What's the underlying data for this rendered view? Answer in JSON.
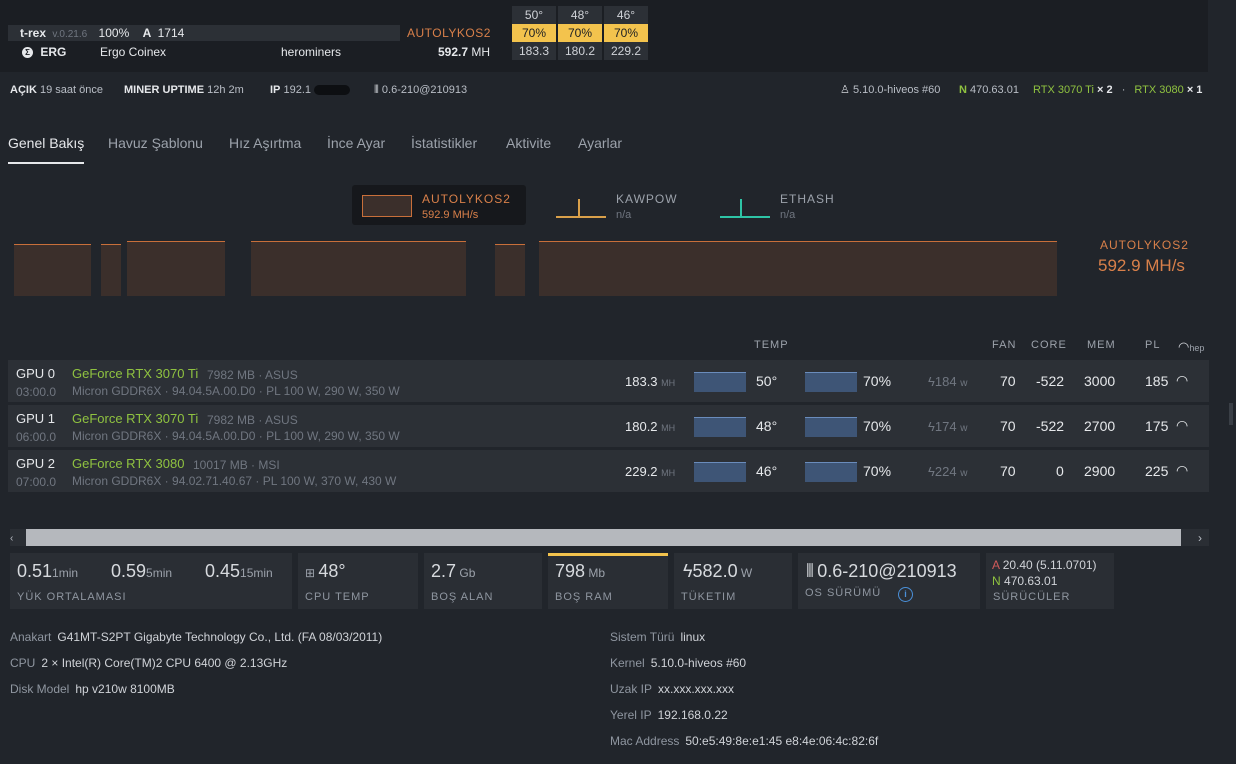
{
  "miner": {
    "name": "t-rex",
    "version": "v.0.21.6",
    "percent": "100%",
    "a_label": "A",
    "a_value": "1714",
    "algo": "AUTOLYKOS2",
    "coin": "ERG",
    "coin_name": "Ergo Coinex",
    "pool": "herominers",
    "hashrate": "592.7",
    "hash_unit": "MH"
  },
  "top_gpus": [
    {
      "temp": "50°",
      "fan": "70%",
      "hash": "183.3"
    },
    {
      "temp": "48°",
      "fan": "70%",
      "hash": "180.2"
    },
    {
      "temp": "46°",
      "fan": "70%",
      "hash": "229.2"
    }
  ],
  "status": {
    "on_label": "AÇIK",
    "on_value": "19 saat önce",
    "uptime_label": "MINER UPTIME",
    "uptime_value": "12h 2m",
    "ip_label": "IP",
    "ip_value": "192.1",
    "version": "0.6-210@210913",
    "kernel": "5.10.0-hiveos #60",
    "nvidia_driver": "470.63.01",
    "gpu_model_1": "RTX 3070 Ti",
    "gpu_count_1": "× 2",
    "gpu_model_2": "RTX 3080",
    "gpu_count_2": "× 1"
  },
  "tabs": [
    "Genel Bakış",
    "Havuz Şablonu",
    "Hız Aşırtma",
    "İnce Ayar",
    "İstatistikler",
    "Aktivite",
    "Ayarlar"
  ],
  "algos": [
    {
      "name": "AUTOLYKOS2",
      "value": "592.9 MH/s",
      "color": "#d9804a"
    },
    {
      "name": "KAWPOW",
      "value": "n/a",
      "color": "#d9a04a"
    },
    {
      "name": "ETHASH",
      "value": "n/a",
      "color": "#2ec4a6"
    }
  ],
  "chart_summary": {
    "name": "AUTOLYKOS2",
    "value": "592.9 MH/s"
  },
  "table_headers": {
    "temp": "TEMP",
    "fan": "FAN",
    "core": "CORE",
    "mem": "MEM",
    "pl": "PL",
    "hep": "hep"
  },
  "gpus": [
    {
      "id": "GPU 0",
      "bus": "03:00.0",
      "model": "GeForce RTX 3070 Ti",
      "vram": "7982 MB · ASUS",
      "details": "Micron GDDR6X · 94.04.5A.00.D0 · PL 100 W, 290 W, 350 W",
      "hash": "183.3",
      "hash_unit": "MH",
      "temp": "50°",
      "fan_pct": "70%",
      "power": "184",
      "power_unit": "w",
      "fan": "70",
      "core": "-522",
      "mem": "3000",
      "pl": "185"
    },
    {
      "id": "GPU 1",
      "bus": "06:00.0",
      "model": "GeForce RTX 3070 Ti",
      "vram": "7982 MB · ASUS",
      "details": "Micron GDDR6X · 94.04.5A.00.D0 · PL 100 W, 290 W, 350 W",
      "hash": "180.2",
      "hash_unit": "MH",
      "temp": "48°",
      "fan_pct": "70%",
      "power": "174",
      "power_unit": "w",
      "fan": "70",
      "core": "-522",
      "mem": "2700",
      "pl": "175"
    },
    {
      "id": "GPU 2",
      "bus": "07:00.0",
      "model": "GeForce RTX 3080",
      "vram": "10017 MB · MSI",
      "details": "Micron GDDR6X · 94.02.71.40.67 · PL 100 W, 370 W, 430 W",
      "hash": "229.2",
      "hash_unit": "MH",
      "temp": "46°",
      "fan_pct": "70%",
      "power": "224",
      "power_unit": "w",
      "fan": "70",
      "core": "0",
      "mem": "2900",
      "pl": "225"
    }
  ],
  "load": {
    "l1": "0.51",
    "u1": "1min",
    "l5": "0.59",
    "u5": "5min",
    "l15": "0.45",
    "u15": "15min",
    "label": "YÜK ORTALAMASI"
  },
  "cpu_temp": {
    "value": "48°",
    "label": "CPU TEMP"
  },
  "disk": {
    "value": "2.7",
    "unit": "Gb",
    "label": "BOŞ ALAN"
  },
  "ram": {
    "value": "798",
    "unit": "Mb",
    "label": "BOŞ RAM"
  },
  "power": {
    "value": "582.0",
    "unit": "W",
    "label": "TÜKETIM"
  },
  "os": {
    "value": "0.6-210@210913",
    "label": "OS SÜRÜMÜ"
  },
  "drivers": {
    "a_label": "A",
    "a_value": "20.40 (5.11.0701)",
    "n_label": "N",
    "n_value": "470.63.01",
    "label": "SÜRÜCÜLER"
  },
  "info_left": [
    {
      "k": "Anakart",
      "v": "G41MT-S2PT Gigabyte Technology Co., Ltd. (FA 08/03/2011)"
    },
    {
      "k": "CPU",
      "v": "2 × Intel(R) Core(TM)2 CPU 6400 @ 2.13GHz"
    },
    {
      "k": "Disk Model",
      "v": "hp v210w 8100MB"
    }
  ],
  "info_right": [
    {
      "k": "Sistem Türü",
      "v": "linux"
    },
    {
      "k": "Kernel",
      "v": "5.10.0-hiveos #60"
    },
    {
      "k": "Uzak IP",
      "v": "xx.xxx.xxx.xxx"
    },
    {
      "k": "Yerel IP",
      "v": "192.168.0.22"
    },
    {
      "k": "Mac Address",
      "v": "50:e5:49:8e:e1:45 e8:4e:06:4c:82:6f"
    }
  ],
  "colors": {
    "accent": "#d9804a",
    "green": "#8fc240",
    "fan_badge": "#f3c34d",
    "ram_highlight": "#f3c34d"
  }
}
